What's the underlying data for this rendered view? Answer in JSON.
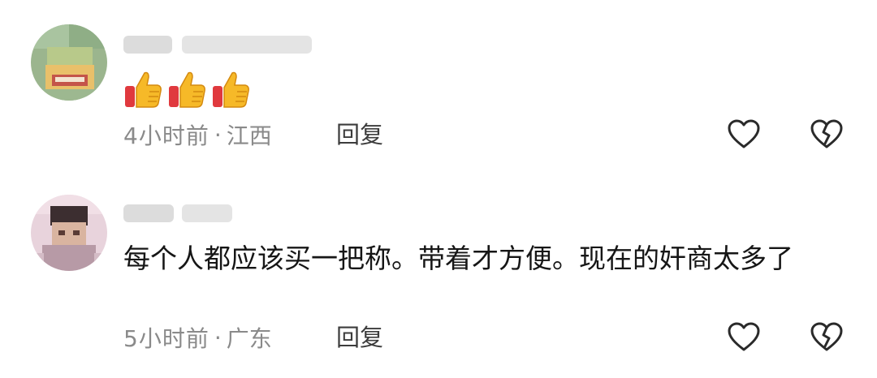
{
  "comments": [
    {
      "body": "",
      "emoji": [
        "👍",
        "👍",
        "👍"
      ],
      "time": "4小时前",
      "separator": "·",
      "location": "江西",
      "reply_label": "回复",
      "like_icon": "heart-outline-icon",
      "dislike_icon": "broken-heart-outline-icon"
    },
    {
      "body": "每个人都应该买一把称。带着才方便。现在的奸商太多了",
      "time": "5小时前",
      "separator": "·",
      "location": "广东",
      "reply_label": "回复",
      "like_icon": "heart-outline-icon",
      "dislike_icon": "broken-heart-outline-icon"
    }
  ],
  "colors": {
    "meta_text": "#8a8a8a",
    "reply_text": "#3c3c3c",
    "icon_stroke": "#2a2a2a",
    "body_text": "#161616"
  }
}
